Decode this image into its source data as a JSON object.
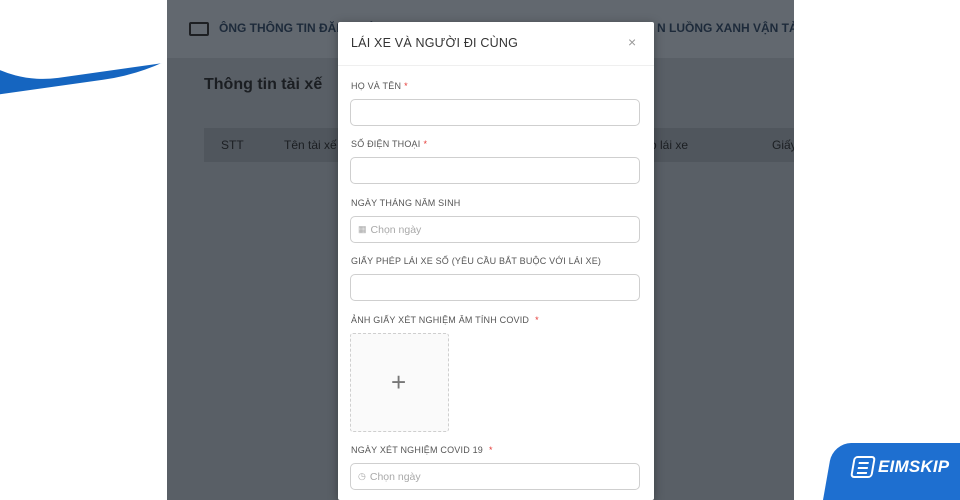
{
  "background_app": {
    "nav_left": "ÔNG THÔNG TIN ĐĂNG KÝ",
    "nav_right": "N LUỒNG XANH VẬN TẢI TOÀN",
    "section_title": "Thông tin tài xế",
    "table_headers": [
      "STT",
      "Tên tài xế",
      "o lái xe",
      "Giấy"
    ]
  },
  "modal": {
    "title": "LÁI XE VÀ NGƯỜI ĐI CÙNG",
    "close_symbol": "×",
    "fields": {
      "full_name": {
        "label": "HỌ VÀ TÊN",
        "required_mark": "*",
        "value": ""
      },
      "phone": {
        "label": "SỐ ĐIỆN THOẠI",
        "required_mark": "*",
        "value": ""
      },
      "dob": {
        "label": "NGÀY THÁNG NĂM SINH",
        "placeholder": "Chọn ngày",
        "icon": "calendar-icon"
      },
      "license": {
        "label": "GIẤY PHÉP LÁI XE SỐ (YÊU CẦU BẮT BUỘC VỚI LÁI XE)",
        "value": ""
      },
      "covid_image": {
        "label": "ẢNH GIẤY XÉT NGHIỆM ÂM TÍNH COVID",
        "required_mark": "*",
        "icon": "plus-icon"
      },
      "covid_date": {
        "label": "NGÀY XÉT NGHIỆM COVID 19",
        "required_mark": "*",
        "placeholder": "Chọn ngày",
        "icon": "clock-icon"
      }
    }
  },
  "brand": {
    "name": "EIMSKIP"
  },
  "colors": {
    "brand_blue": "#1e6fd0",
    "required_red": "#e53935",
    "overlay": "#555b63"
  }
}
